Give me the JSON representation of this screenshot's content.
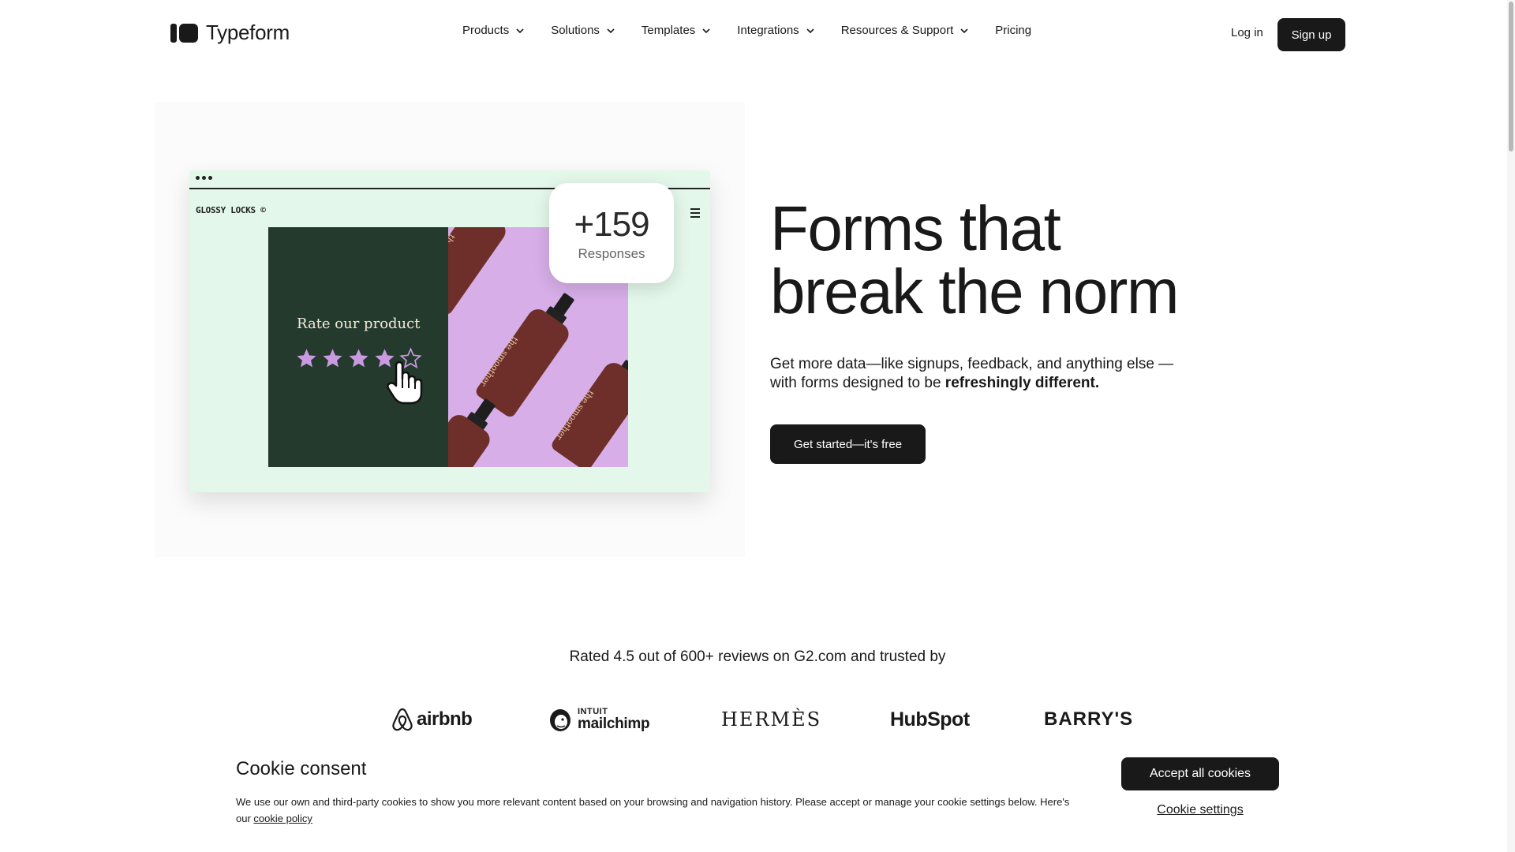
{
  "header": {
    "logo_text": "Typeform",
    "nav": [
      {
        "label": "Products",
        "has_dropdown": true
      },
      {
        "label": "Solutions",
        "has_dropdown": true
      },
      {
        "label": "Templates",
        "has_dropdown": true
      },
      {
        "label": "Integrations",
        "has_dropdown": true
      },
      {
        "label": "Resources & Support",
        "has_dropdown": true
      },
      {
        "label": "Pricing",
        "has_dropdown": false
      }
    ],
    "login_label": "Log in",
    "signup_label": "Sign up"
  },
  "hero": {
    "preview": {
      "brand_name": "GLOSSY LOCKS ©",
      "rate_label": "Rate our product",
      "stars_filled": 4,
      "stars_total": 5,
      "bottle_label": "the smoother"
    },
    "badge": {
      "number": "+159",
      "label": "Responses"
    },
    "headline_line1": "Forms that",
    "headline_line2": "break the norm",
    "subtext_regular": "Get more data—like signups, feedback, and anything else —with forms designed to be ",
    "subtext_bold": "refreshingly different.",
    "cta_label": "Get started—it's free"
  },
  "trust": {
    "rated_text": "Rated 4.5 out of 600+ reviews on G2.com and trusted by",
    "logos": [
      {
        "name": "airbnb",
        "text": "airbnb"
      },
      {
        "name": "mailchimp",
        "text_top": "INTUIT",
        "text_bottom": "mailchimp"
      },
      {
        "name": "hermes",
        "text": "HERMÈS"
      },
      {
        "name": "hubspot",
        "text": "HubSpot"
      },
      {
        "name": "barrys",
        "text": "BARRY'S"
      }
    ]
  },
  "cookie": {
    "title": "Cookie consent",
    "text": "We use our own and third-party cookies to show you more relevant content based on your browsing and navigation history. Please accept or manage your cookie settings below. Here's our ",
    "link_label": "cookie policy",
    "accept_label": "Accept all cookies",
    "settings_label": "Cookie settings"
  },
  "colors": {
    "ink": "#191919",
    "preview_background": "#e3f7ea",
    "card_green": "#233a2d",
    "card_lilac": "#d7aee8",
    "star": "#c99ae0"
  }
}
